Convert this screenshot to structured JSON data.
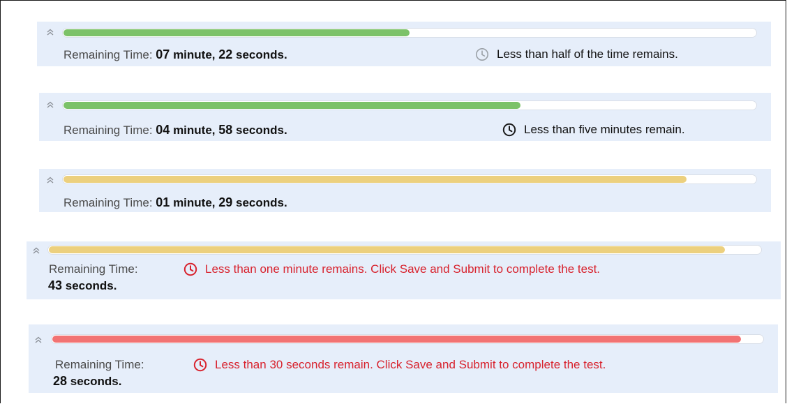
{
  "colors": {
    "panel_bg": "#e6eefa",
    "green_fill": "#7cc268",
    "yellow_fill": "#ecd07e",
    "red_fill": "#f27373",
    "warning_red": "#d8222d",
    "clock_gray": "#9aa0a6",
    "clock_dark": "#1a1a1a"
  },
  "timers": [
    {
      "progress_percent": 50,
      "fill_color": "#7cc268",
      "label": "Remaining Time:",
      "minutes": "07",
      "minutes_unit": "minute,",
      "seconds": "22",
      "seconds_unit": "seconds.",
      "message": "Less than half of the time remains.",
      "icon": "clock-icon"
    },
    {
      "progress_percent": 66,
      "fill_color": "#7cc268",
      "label": "Remaining Time:",
      "minutes": "04",
      "minutes_unit": "minute,",
      "seconds": "58",
      "seconds_unit": "seconds.",
      "message": "Less than five minutes remain.",
      "icon": "clock-icon"
    },
    {
      "progress_percent": 90,
      "fill_color": "#ecd07e",
      "label": "Remaining Time:",
      "minutes": "01",
      "minutes_unit": "minute,",
      "seconds": "29",
      "seconds_unit": "seconds."
    },
    {
      "progress_percent": 95,
      "fill_color": "#ecd07e",
      "label": "Remaining Time:",
      "seconds": "43",
      "seconds_unit": "seconds.",
      "message": "Less than one minute remains. Click Save and Submit to complete the test.",
      "icon": "clock-icon"
    },
    {
      "progress_percent": 97,
      "fill_color": "#f27373",
      "label": "Remaining Time:",
      "seconds": "28",
      "seconds_unit": "seconds.",
      "message": "Less than 30 seconds remain. Click Save and Submit to complete the test.",
      "icon": "clock-icon"
    }
  ]
}
